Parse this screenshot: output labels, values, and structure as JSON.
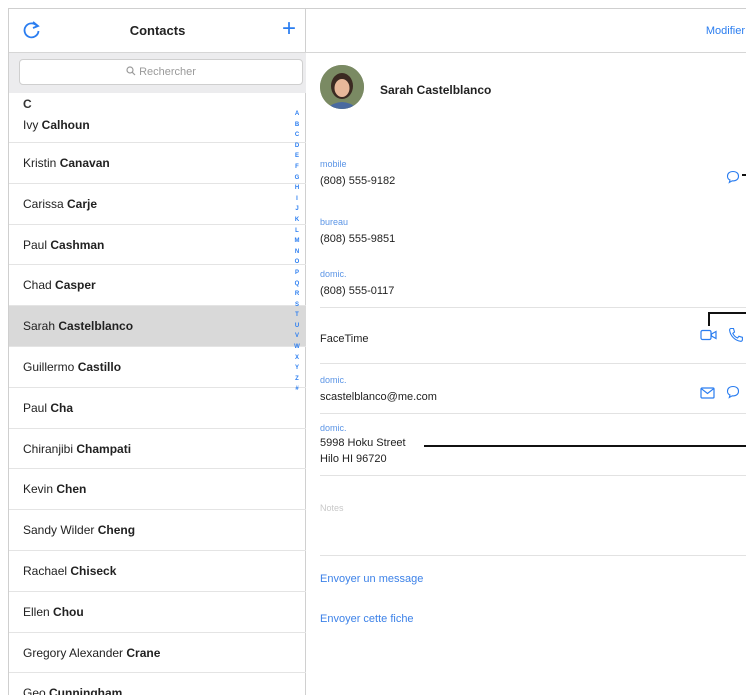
{
  "left_header": {
    "title": "Contacts",
    "add_label": "+"
  },
  "search": {
    "placeholder": "Rechercher"
  },
  "section_letter": "C",
  "contacts": [
    {
      "first": "Ivy ",
      "last": "Calhoun"
    },
    {
      "first": "Kristin ",
      "last": "Canavan"
    },
    {
      "first": "Carissa ",
      "last": "Carje"
    },
    {
      "first": "Paul ",
      "last": "Cashman"
    },
    {
      "first": "Chad ",
      "last": "Casper"
    },
    {
      "first": "Sarah ",
      "last": "Castelblanco"
    },
    {
      "first": "Guillermo ",
      "last": "Castillo"
    },
    {
      "first": "Paul ",
      "last": "Cha"
    },
    {
      "first": "Chiranjibi ",
      "last": "Champati"
    },
    {
      "first": "Kevin ",
      "last": "Chen"
    },
    {
      "first": "Sandy Wilder ",
      "last": "Cheng"
    },
    {
      "first": "Rachael ",
      "last": "Chiseck"
    },
    {
      "first": "Ellen ",
      "last": "Chou"
    },
    {
      "first": "Gregory Alexander ",
      "last": "Crane"
    },
    {
      "first": "Geo ",
      "last": "Cunningham"
    }
  ],
  "index_letters": [
    "A",
    "B",
    "C",
    "D",
    "E",
    "F",
    "G",
    "H",
    "I",
    "J",
    "K",
    "L",
    "M",
    "N",
    "O",
    "P",
    "Q",
    "R",
    "S",
    "T",
    "U",
    "V",
    "W",
    "X",
    "Y",
    "Z",
    "#"
  ],
  "detail": {
    "edit_label": "Modifier",
    "name": "Sarah Castelblanco",
    "phones": [
      {
        "label": "mobile",
        "value": "(808) 555-9182"
      },
      {
        "label": "bureau",
        "value": "(808) 555-9851"
      },
      {
        "label": "domic.",
        "value": "(808) 555-0117"
      }
    ],
    "facetime_label": "FaceTime",
    "email": {
      "label": "domic.",
      "value": "scastelblanco@me.com"
    },
    "address": {
      "label": "domic.",
      "line1": "5998 Hoku Street",
      "line2": "Hilo HI 96720"
    },
    "notes_label": "Notes",
    "action_message": "Envoyer un message",
    "action_share": "Envoyer cette fiche"
  },
  "colors": {
    "accent": "#2a7df0",
    "selected_row": "#d9d9d9"
  }
}
